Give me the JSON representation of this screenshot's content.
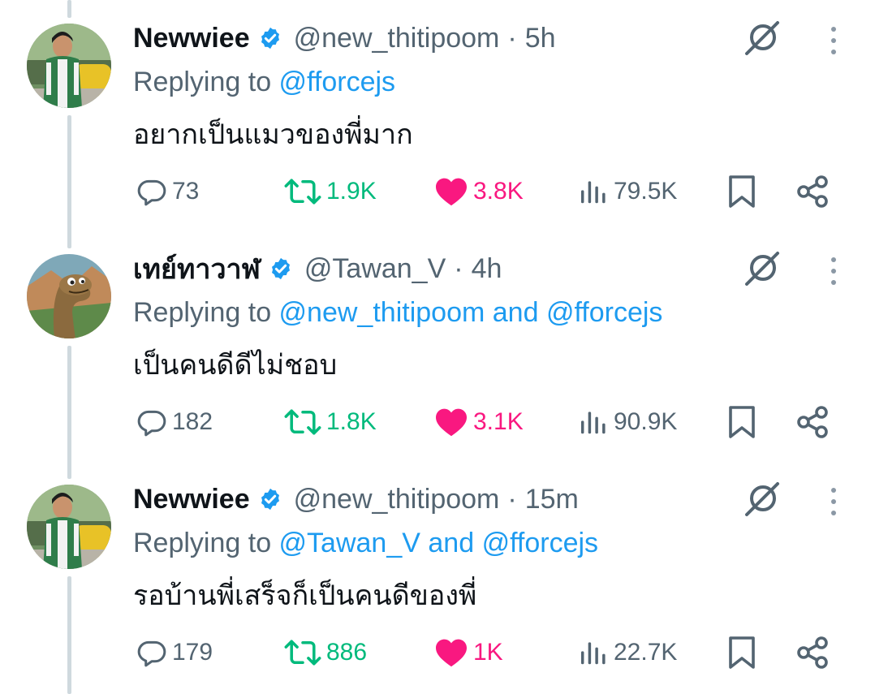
{
  "tweets": [
    {
      "name": "Newwiee",
      "handle": "@new_thitipoom",
      "dot": "·",
      "time": "5h",
      "replying_prefix": "Replying to ",
      "mention_1": "@fforcejs",
      "mention_joiner": "",
      "mention_2": "",
      "text": "อยากเป็นแมวของพี่มาก",
      "replies": "73",
      "retweets": "1.9K",
      "likes": "3.8K",
      "views": "79.5K",
      "avatar": "person-portrait"
    },
    {
      "name": "เทย์ทาวาฬ",
      "handle": "@Tawan_V",
      "dot": "·",
      "time": "4h",
      "replying_prefix": "Replying to ",
      "mention_1": "@new_thitipoom",
      "mention_joiner": " and ",
      "mention_2": "@fforcejs",
      "text": "เป็นคนดีดีไม่ชอบ",
      "replies": "182",
      "retweets": "1.8K",
      "likes": "3.1K",
      "views": "90.9K",
      "avatar": "dinosaur-cartoon"
    },
    {
      "name": "Newwiee",
      "handle": "@new_thitipoom",
      "dot": "·",
      "time": "15m",
      "replying_prefix": "Replying to ",
      "mention_1": "@Tawan_V",
      "mention_joiner": " and ",
      "mention_2": "@fforcejs",
      "text": "รอบ้านพี่เสร็จก็เป็นคนดีของพี่",
      "replies": "179",
      "retweets": "886",
      "likes": "1K",
      "views": "22.7K",
      "avatar": "person-portrait"
    }
  ],
  "colors": {
    "link": "#1d9bf0",
    "muted": "#536471",
    "retweet": "#00ba7c",
    "like": "#f91880",
    "thread_line": "#cfd9de"
  }
}
